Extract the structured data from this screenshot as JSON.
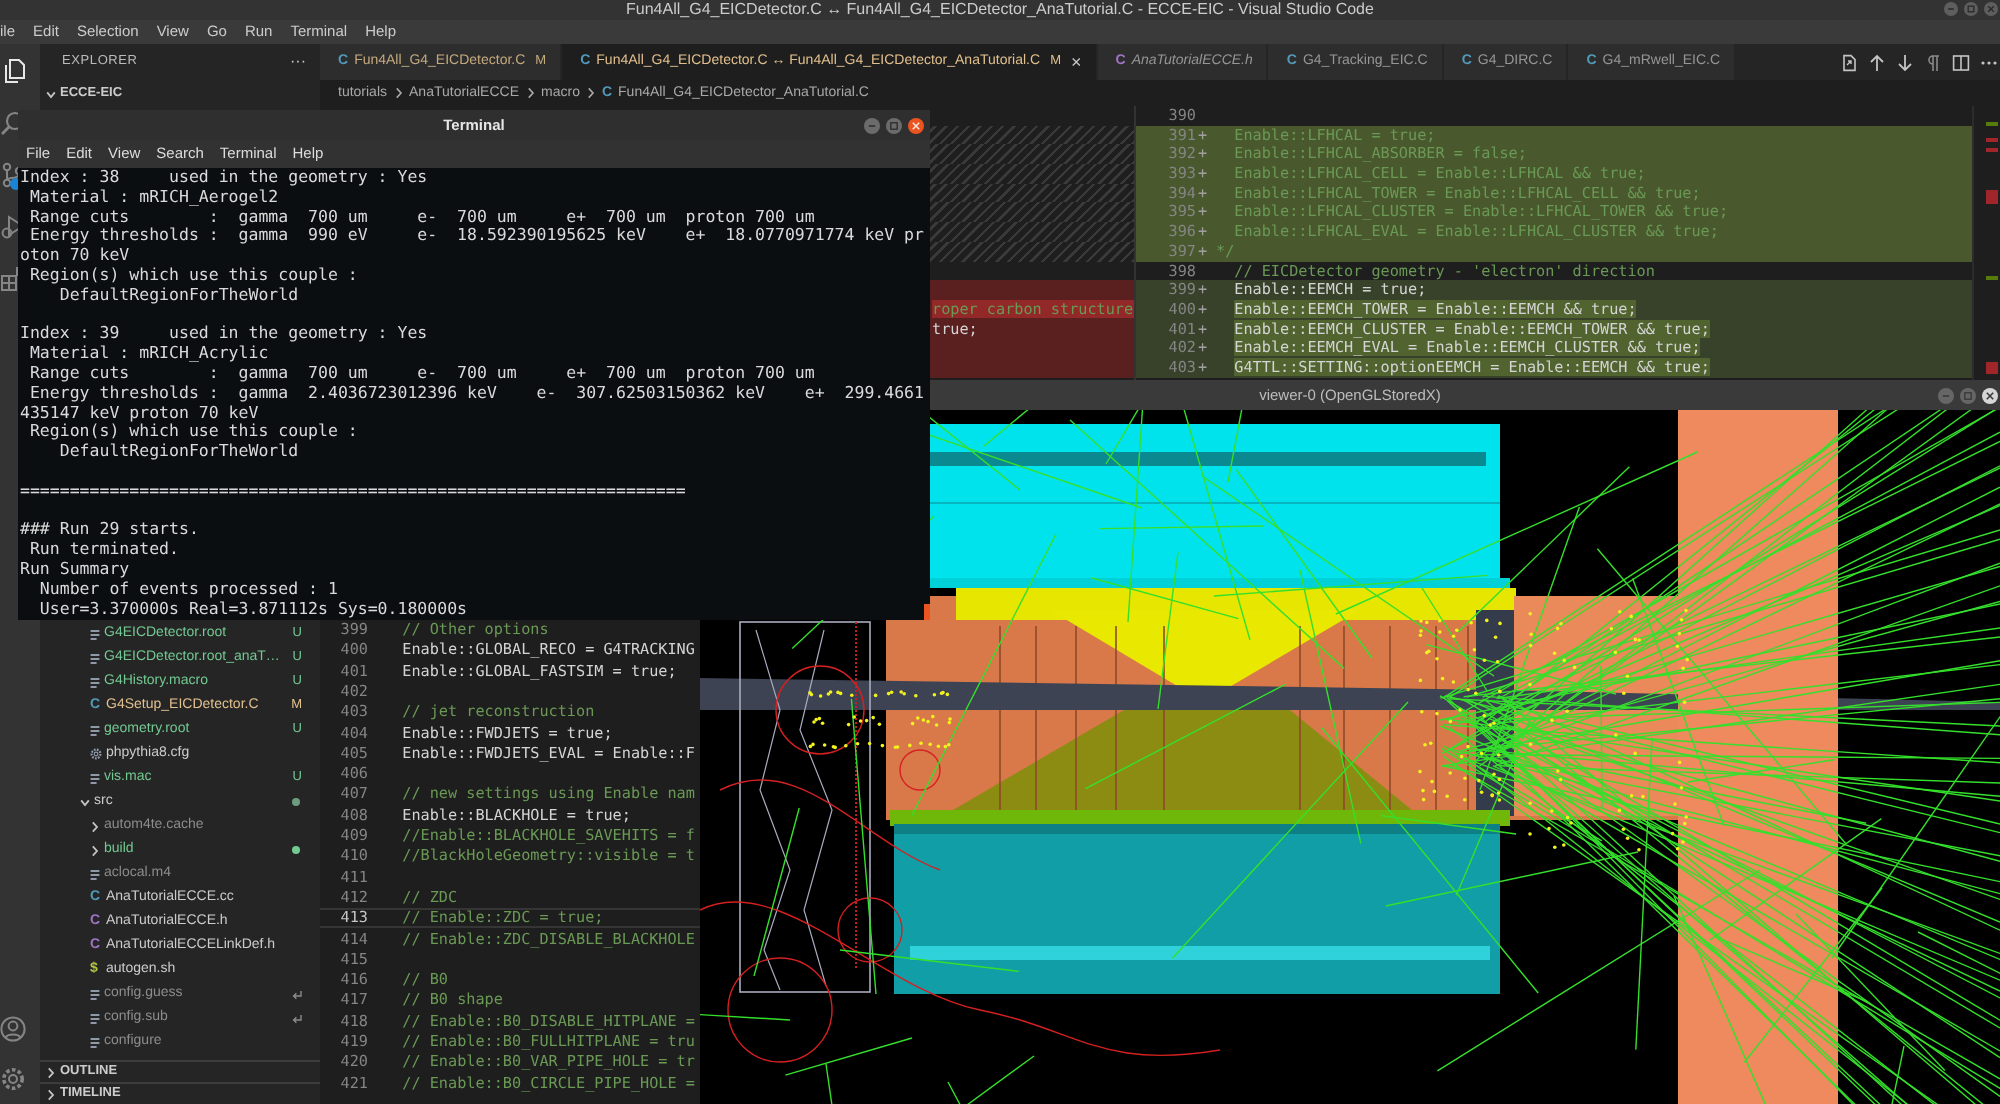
{
  "title_bar": {
    "title": "Fun4All_G4_EICDetector.C ↔ Fun4All_G4_EICDetector_AnaTutorial.C - ECCE-EIC - Visual Studio Code"
  },
  "menu_bar": [
    "ile",
    "Edit",
    "Selection",
    "View",
    "Go",
    "Run",
    "Terminal",
    "Help"
  ],
  "activity_bar": {
    "items": [
      {
        "kind": "explorer",
        "selected": true
      },
      {
        "kind": "search",
        "selected": false
      },
      {
        "kind": "source_control",
        "selected": false,
        "badge": true
      },
      {
        "kind": "debug",
        "selected": false
      },
      {
        "kind": "extensions",
        "selected": false
      }
    ],
    "bottom": [
      {
        "kind": "account"
      },
      {
        "kind": "settings"
      }
    ]
  },
  "explorer": {
    "title": "EXPLORER",
    "more": "···",
    "section": {
      "name": "ECCE-EIC",
      "expanded": true
    },
    "tree": [
      {
        "children": [
          {
            "name": "G4EICDetector.root",
            "kind": "file",
            "untracked": true,
            "status": "U"
          },
          {
            "name": "G4EICDetector.root_anaT…",
            "kind": "file",
            "untracked": true,
            "status": "U"
          },
          {
            "name": "G4History.macro",
            "kind": "file",
            "untracked": true,
            "status": "U"
          },
          {
            "name": "G4Setup_EICDetector.C",
            "kind": "c",
            "icon": "C",
            "modified": true,
            "status": "M"
          },
          {
            "name": "geometry.root",
            "kind": "file",
            "untracked": true,
            "status": "U"
          },
          {
            "name": "phpythia8.cfg",
            "kind": "config"
          },
          {
            "name": "vis.mac",
            "kind": "file",
            "untracked": true,
            "status": "U"
          }
        ]
      },
      {
        "name": "src",
        "kind": "folder",
        "expanded": true,
        "dot": true,
        "children": [
          {
            "name": "autom4te.cache",
            "kind": "folder",
            "expanded": false,
            "ignored": true
          },
          {
            "name": "build",
            "kind": "folder",
            "expanded": false,
            "untracked": true,
            "dot": true
          },
          {
            "name": "aclocal.m4",
            "kind": "file",
            "ignored": true
          },
          {
            "name": "AnaTutorialECCE.cc",
            "kind": "cpp",
            "icon": "C"
          },
          {
            "name": "AnaTutorialECCE.h",
            "kind": "header",
            "icon": "C"
          },
          {
            "name": "AnaTutorialECCELinkDef.h",
            "kind": "header",
            "icon": "C"
          },
          {
            "name": "autogen.sh",
            "kind": "shell",
            "icon": "$"
          },
          {
            "name": "config.guess",
            "kind": "file",
            "ignored": true,
            "link": true
          },
          {
            "name": "config.sub",
            "kind": "file",
            "ignored": true,
            "link": true
          },
          {
            "name": "configure",
            "kind": "file",
            "ignored": true
          }
        ]
      }
    ],
    "panels": [
      {
        "name": "OUTLINE",
        "expanded": false
      },
      {
        "name": "TIMELINE",
        "expanded": false
      }
    ]
  },
  "tabs": [
    {
      "icon": "C",
      "label": "Fun4All_G4_EICDetector.C",
      "kind": "c",
      "modified": true,
      "status": "M",
      "preview": false,
      "selected": false
    },
    {
      "icon": "C",
      "label": "Fun4All_G4_EICDetector.C ↔ Fun4All_G4_EICDetector_AnaTutorial.C",
      "kind": "c",
      "modified": true,
      "status": "M",
      "preview": false,
      "selected": true,
      "close": "×"
    },
    {
      "icon": "C",
      "label": "AnaTutorialECCE.h",
      "kind": "header",
      "modified": false,
      "preview": true,
      "selected": false
    },
    {
      "icon": "C",
      "label": "G4_Tracking_EIC.C",
      "kind": "c",
      "modified": false,
      "preview": false,
      "selected": false
    },
    {
      "icon": "C",
      "label": "G4_DIRC.C",
      "kind": "c",
      "modified": false,
      "preview": false,
      "selected": false
    },
    {
      "icon": "C",
      "label": "G4_mRwell_EIC.C",
      "kind": "c",
      "modified": false,
      "preview": false,
      "selected": false
    }
  ],
  "editor_actions": [
    {
      "kind": "open_file"
    },
    {
      "kind": "previous_change"
    },
    {
      "kind": "next_change"
    },
    {
      "kind": "whitespace"
    },
    {
      "kind": "split"
    },
    {
      "kind": "more"
    }
  ],
  "breadcrumb": [
    {
      "label": "tutorials"
    },
    {
      "label": "AnaTutorialECCE"
    },
    {
      "label": "macro"
    },
    {
      "label": "Fun4All_G4_EICDetector_AnaTutorial.C",
      "icon": "C"
    }
  ],
  "diff": {
    "original_top": [
      {
        "kind": "context"
      },
      {
        "kind": "filler"
      },
      {
        "kind": "filler"
      },
      {
        "kind": "filler"
      },
      {
        "kind": "filler"
      },
      {
        "kind": "filler"
      },
      {
        "kind": "filler"
      },
      {
        "kind": "filler"
      },
      {
        "kind": "context"
      },
      {
        "kind": "removed"
      },
      {
        "kind": "removed",
        "highlight": true,
        "comment": true,
        "code": "roper carbon structure"
      },
      {
        "kind": "removed",
        "highlight": false,
        "comment": false,
        "code": "true;"
      },
      {
        "kind": "removed"
      },
      {
        "kind": "removed"
      }
    ],
    "original_bottom": [
      {
        "number": "399",
        "current": false,
        "comment": true,
        "code": "  // Other options"
      },
      {
        "number": "400",
        "current": false,
        "comment": false,
        "code": "  Enable::GLOBAL_RECO = G4TRACKING"
      },
      {
        "number": "401",
        "current": false,
        "comment": false,
        "code": "  Enable::GLOBAL_FASTSIM = true;"
      },
      {
        "number": "402",
        "current": false
      },
      {
        "number": "403",
        "current": false,
        "comment": true,
        "code": "  // jet reconstruction"
      },
      {
        "number": "404",
        "current": false,
        "comment": false,
        "code": "  Enable::FWDJETS = true;"
      },
      {
        "number": "405",
        "current": false,
        "comment": false,
        "code": "  Enable::FWDJETS_EVAL = Enable::F"
      },
      {
        "number": "406",
        "current": false
      },
      {
        "number": "407",
        "current": false,
        "comment": true,
        "code": "  // new settings using Enable nam"
      },
      {
        "number": "408",
        "current": false,
        "comment": false,
        "code": "  Enable::BLACKHOLE = true;"
      },
      {
        "number": "409",
        "current": false,
        "comment": true,
        "code": "  //Enable::BLACKHOLE_SAVEHITS = f"
      },
      {
        "number": "410",
        "current": false,
        "comment": true,
        "code": "  //BlackHoleGeometry::visible = t"
      },
      {
        "number": "411",
        "current": false
      },
      {
        "number": "412",
        "current": false,
        "comment": true,
        "code": "  // ZDC"
      },
      {
        "number": "413",
        "current": true,
        "comment": true,
        "code": "  // Enable::ZDC = true;"
      },
      {
        "number": "414",
        "current": false,
        "comment": true,
        "code": "  // Enable::ZDC_DISABLE_BLACKHOLE"
      },
      {
        "number": "415",
        "current": false
      },
      {
        "number": "416",
        "current": false,
        "comment": true,
        "code": "  // B0"
      },
      {
        "number": "417",
        "current": false,
        "comment": true,
        "code": "  // B0 shape"
      },
      {
        "number": "418",
        "current": false,
        "comment": true,
        "code": "  // Enable::B0_DISABLE_HITPLANE ="
      },
      {
        "number": "419",
        "current": false,
        "comment": true,
        "code": "  // Enable::B0_FULLHITPLANE = tru"
      },
      {
        "number": "420",
        "current": false,
        "comment": true,
        "code": "  // Enable::B0_VAR_PIPE_HOLE = tr"
      },
      {
        "number": "421",
        "current": false,
        "comment": true,
        "code": "  // Enable::B0_CIRCLE_PIPE_HOLE ="
      }
    ],
    "modified": [
      {
        "number": "390",
        "kind": "context"
      },
      {
        "number": "391",
        "sign": "+",
        "kind": "inserted",
        "comment": true,
        "code": "  Enable::LFHCAL = true;"
      },
      {
        "number": "392",
        "sign": "+",
        "kind": "inserted",
        "comment": true,
        "code": "  Enable::LFHCAL_ABSORBER = false;"
      },
      {
        "number": "393",
        "sign": "+",
        "kind": "inserted",
        "comment": true,
        "code": "  Enable::LFHCAL_CELL = Enable::LFHCAL && true;"
      },
      {
        "number": "394",
        "sign": "+",
        "kind": "inserted",
        "comment": true,
        "code": "  Enable::LFHCAL_TOWER = Enable::LFHCAL_CELL && true;"
      },
      {
        "number": "395",
        "sign": "+",
        "kind": "inserted",
        "comment": true,
        "code": "  Enable::LFHCAL_CLUSTER = Enable::LFHCAL_TOWER && true;"
      },
      {
        "number": "396",
        "sign": "+",
        "kind": "inserted",
        "comment": true,
        "code": "  Enable::LFHCAL_EVAL = Enable::LFHCAL_CLUSTER && true;"
      },
      {
        "number": "397",
        "sign": "+",
        "kind": "inserted",
        "comment": true,
        "code": "*/"
      },
      {
        "number": "398",
        "kind": "context",
        "comment": true,
        "code": "  // EICDetector geometry - 'electron' direction"
      },
      {
        "number": "399",
        "sign": "+",
        "kind": "added",
        "highlight": false,
        "comment": false,
        "code": "  Enable::EEMCH = true;"
      },
      {
        "number": "400",
        "sign": "+",
        "kind": "added",
        "highlight": true,
        "comment": false,
        "code": "  Enable::EEMCH_TOWER = Enable::EEMCH && true;"
      },
      {
        "number": "401",
        "sign": "+",
        "kind": "added",
        "highlight": true,
        "comment": false,
        "code": "  Enable::EEMCH_CLUSTER = Enable::EEMCH_TOWER && true;"
      },
      {
        "number": "402",
        "sign": "+",
        "kind": "added",
        "highlight": true,
        "comment": false,
        "code": "  Enable::EEMCH_EVAL = Enable::EEMCH_CLUSTER && true;"
      },
      {
        "number": "403",
        "sign": "+",
        "kind": "added",
        "highlight": true,
        "comment": false,
        "code": "  G4TTL::SETTING::optionEEMCH = Enable::EEMCH && true;"
      }
    ]
  },
  "terminal": {
    "title": "Terminal",
    "menu": [
      "File",
      "Edit",
      "View",
      "Search",
      "Terminal",
      "Help"
    ],
    "blocks": [
      [
        "Index : 38     used in the geometry : Yes",
        " Material : mRICH_Aerogel2",
        " Range cuts        :  gamma  700 um     e-  700 um     e+  700 um  proton 700 um",
        " Energy thresholds :  gamma  990 eV     e-  18.592390195625 keV    e+  18.0770971774 keV pr",
        "oton 70 keV",
        " Region(s) which use this couple :",
        "    DefaultRegionForTheWorld"
      ],
      [
        "Index : 39     used in the geometry : Yes",
        " Material : mRICH_Acrylic",
        " Range cuts        :  gamma  700 um     e-  700 um     e+  700 um  proton 700 um",
        " Energy thresholds :  gamma  2.4036723012396 keV    e-  307.62503150362 keV    e+  299.4661",
        "435147 keV proton 70 keV",
        " Region(s) which use this couple :",
        "    DefaultRegionForTheWorld"
      ],
      [
        "==================================================================="
      ],
      [
        "### Run 29 starts.",
        " Run terminated.",
        "Run Summary",
        "  Number of events processed : 1",
        "  User=3.370000s Real=3.871112s Sys=0.180000s"
      ]
    ]
  },
  "viewer": {
    "title": "viewer-0 (OpenGLStoredX)"
  }
}
